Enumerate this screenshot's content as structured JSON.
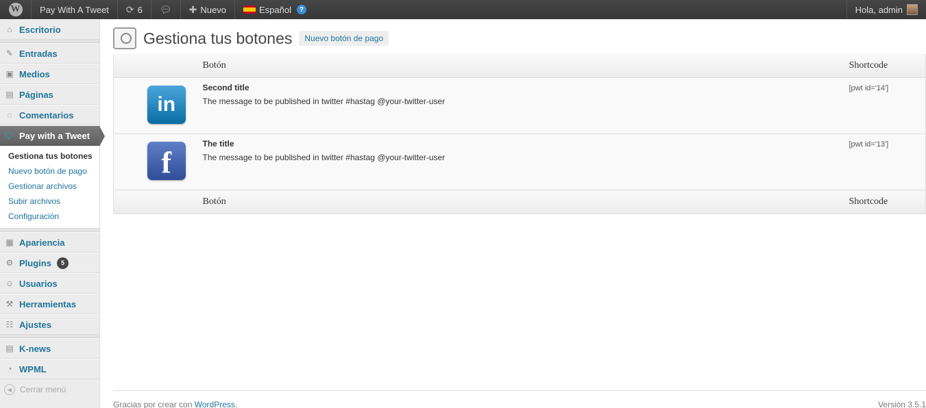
{
  "adminbar": {
    "site_name": "Pay With A Tweet",
    "updates_count": "6",
    "new_label": "Nuevo",
    "language": "Español",
    "greeting": "Hola, admin"
  },
  "sidebar": {
    "items": [
      {
        "label": "Escritorio",
        "icon": "dashboard-icon"
      },
      {
        "label": "Entradas",
        "icon": "pin-icon"
      },
      {
        "label": "Medios",
        "icon": "media-icon"
      },
      {
        "label": "Páginas",
        "icon": "pages-icon"
      },
      {
        "label": "Comentarios",
        "icon": "comments-icon"
      },
      {
        "label": "Pay with a Tweet",
        "icon": "twitter-bird-icon"
      },
      {
        "label": "Apariencia",
        "icon": "appearance-icon"
      },
      {
        "label": "Plugins",
        "icon": "plugins-icon",
        "badge": "5"
      },
      {
        "label": "Usuarios",
        "icon": "users-icon"
      },
      {
        "label": "Herramientas",
        "icon": "tools-icon"
      },
      {
        "label": "Ajustes",
        "icon": "settings-icon"
      },
      {
        "label": "K-news",
        "icon": "news-icon"
      },
      {
        "label": "WPML",
        "icon": "wpml-icon"
      }
    ],
    "submenu": [
      "Gestiona tus botones",
      "Nuevo botón de pago",
      "Gestionar archivos",
      "Subir archivos",
      "Configuración"
    ],
    "collapse_label": "Cerrar menú"
  },
  "main": {
    "title": "Gestiona tus botones",
    "add_new_label": "Nuevo botón de pago",
    "table": {
      "headers": {
        "button": "Botón",
        "shortcode": "Shortcode"
      },
      "rows": [
        {
          "icon": "linkedin-icon",
          "title": "Second title",
          "message": "The message to be published in twitter #hastag @your-twitter-user",
          "shortcode": "[pwt id='14']"
        },
        {
          "icon": "facebook-icon",
          "title": "The title",
          "message": "The message to be published in twitter #hastag @your-twitter-user",
          "shortcode": "[pwt id='13']"
        }
      ]
    }
  },
  "footer": {
    "thanks_prefix": "Gracias por crear con",
    "wordpress_link": "WordPress",
    "version": "Versión 3.5.1"
  },
  "colors": {
    "link": "#21759b",
    "adminbar": "#464646",
    "active_menu": "#6b6b6b"
  }
}
